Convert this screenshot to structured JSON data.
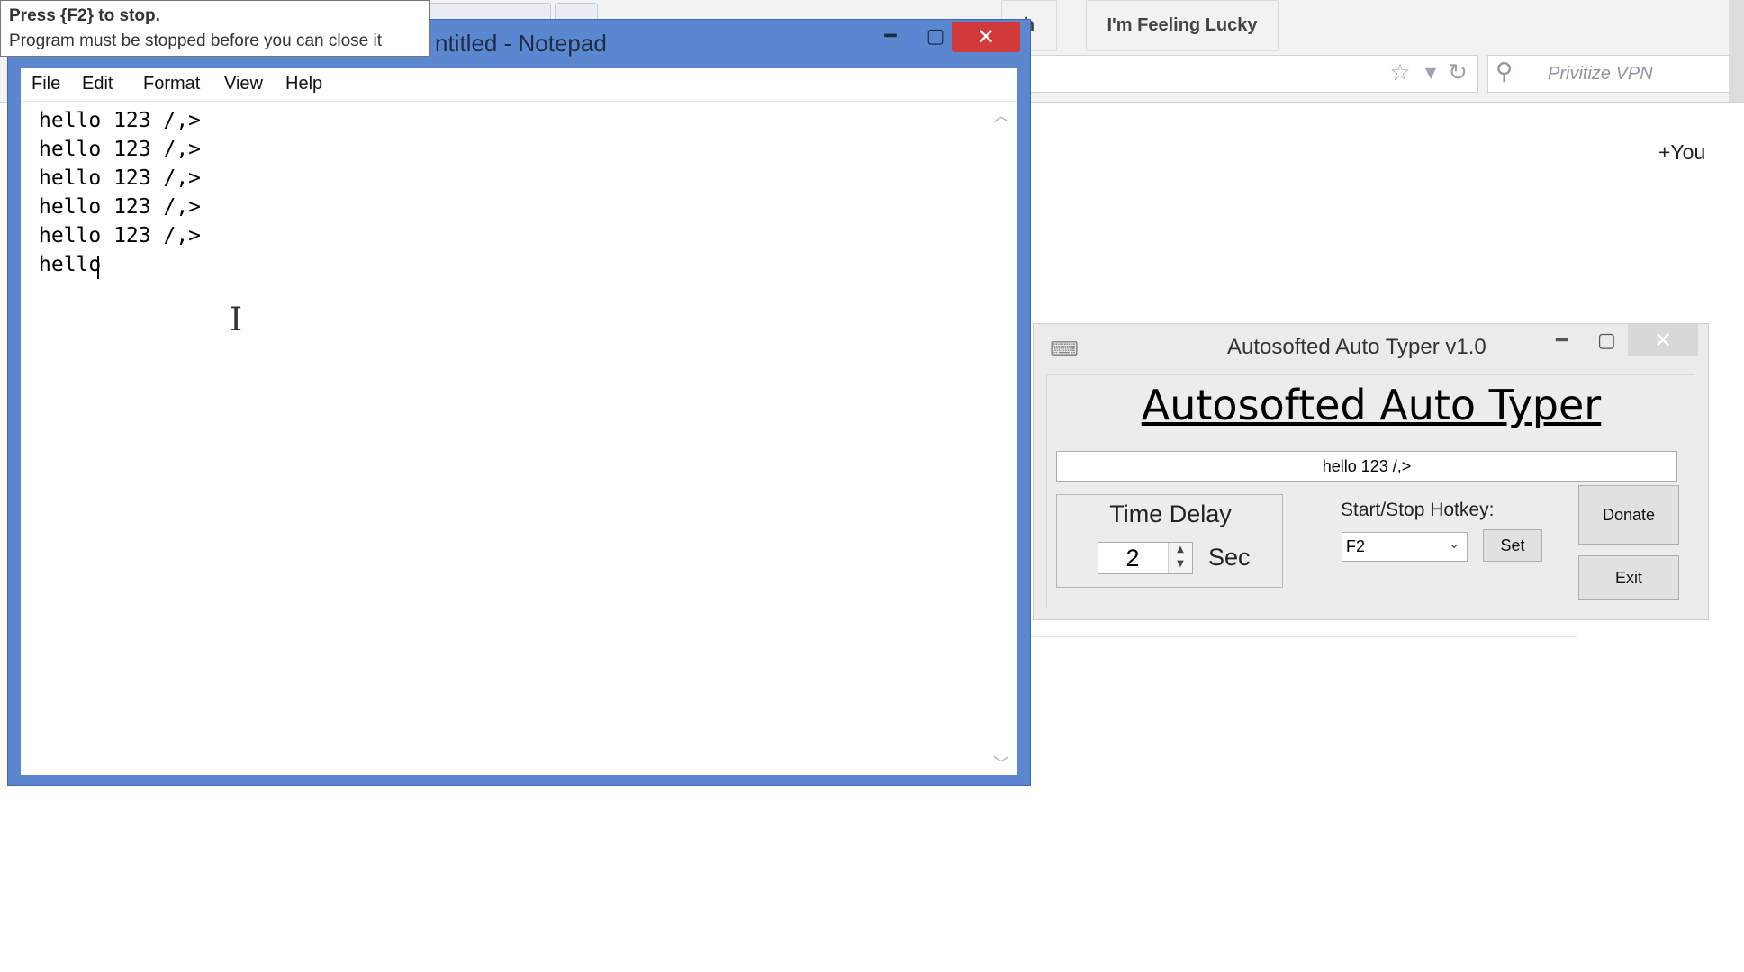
{
  "browser": {
    "search_placeholder": "Privitize VPN",
    "you_link": "+You",
    "feeling_lucky": "I'm Feeling Lucky",
    "partial_search_button": "h"
  },
  "tooltip": {
    "line1": "Press {F2} to stop.",
    "line2": "Program must be stopped before you can close it"
  },
  "notepad": {
    "title": "ntitled - Notepad",
    "menu": [
      "File",
      "Edit",
      "Format",
      "View",
      "Help"
    ],
    "lines": [
      "hello 123 /,>",
      "hello 123 /,>",
      "hello 123 /,>",
      "hello 123 /,>",
      "hello 123 /,>",
      "hello"
    ]
  },
  "auto_typer": {
    "window_title": "Autosofted Auto Typer v1.0",
    "heading": "Autosofted Auto Typer",
    "text_to_type": "hello 123 /,>",
    "time_delay_label": "Time Delay",
    "delay_value": "2",
    "delay_unit": "Sec",
    "hotkey_label": "Start/Stop Hotkey:",
    "hotkey_value": "F2",
    "set_button": "Set",
    "donate_button": "Donate",
    "exit_button": "Exit"
  },
  "icons": {
    "minimize": "minimize-icon",
    "maximize": "maximize-icon",
    "close": "close-icon",
    "star": "star-icon",
    "refresh": "refresh-icon",
    "search": "search-icon",
    "keyboard": "keyboard-icon"
  },
  "colors": {
    "notepad_frame": "#5a87cf",
    "close_button": "#d13a3a"
  }
}
